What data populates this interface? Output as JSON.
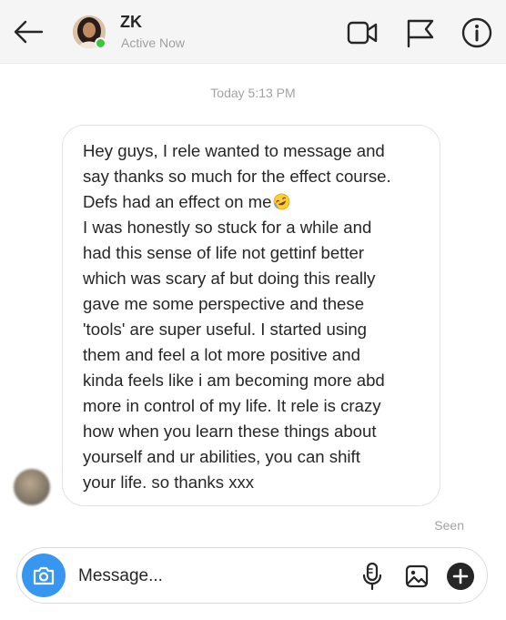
{
  "header": {
    "name": "ZK",
    "status": "Active Now"
  },
  "icons": {
    "back": "back-arrow-icon",
    "video": "video-call-icon",
    "report": "flag-icon",
    "info": "info-icon",
    "camera": "camera-icon",
    "mic": "microphone-icon",
    "gallery": "gallery-icon",
    "more": "plus-icon",
    "emoji": "rolling-laughing-emoji"
  },
  "thread": {
    "timestamp": "Today 5:13 PM",
    "message_lines": [
      "Hey guys, I rele wanted to message and",
      "say thanks so much for the effect course.",
      "Defs had an effect on me",
      "I was honestly so stuck for a while and",
      "had this sense of life not gettinf better",
      "which was scary af but doing this really",
      "gave me some perspective and these",
      "'tools' are super useful. I started using",
      "them and feel a lot more positive and",
      "kinda feels like i am becoming more abd",
      "more in control of my life. It rele is crazy",
      "how when you learn these things about",
      "yourself and ur abilities, you can shift",
      "your life. so thanks xxx"
    ],
    "seen": "Seen"
  },
  "composer": {
    "placeholder": "Message..."
  },
  "colors": {
    "accent": "#3797f0",
    "online": "#3ec43e",
    "header_bg": "#f5f5f5",
    "muted_text": "#a3a3a3"
  }
}
